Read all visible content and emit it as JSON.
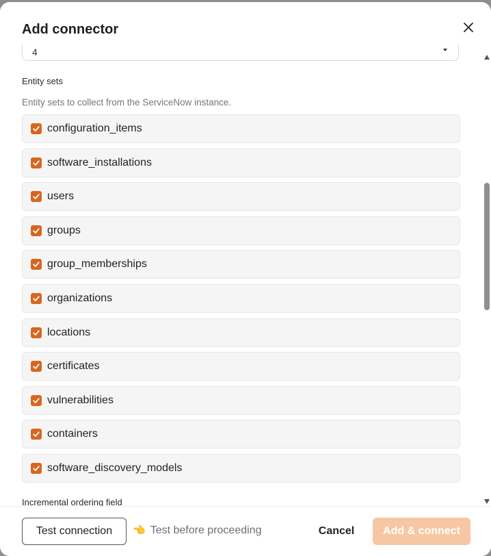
{
  "dialog": {
    "title": "Add connector",
    "close_icon": "close-icon"
  },
  "previous_field": {
    "value": "4"
  },
  "entity_sets": {
    "label": "Entity sets",
    "description": "Entity sets to collect from the ServiceNow instance.",
    "items": [
      {
        "label": "configuration_items",
        "checked": true
      },
      {
        "label": "software_installations",
        "checked": true
      },
      {
        "label": "users",
        "checked": true
      },
      {
        "label": "groups",
        "checked": true
      },
      {
        "label": "group_memberships",
        "checked": true
      },
      {
        "label": "organizations",
        "checked": true
      },
      {
        "label": "locations",
        "checked": true
      },
      {
        "label": "certificates",
        "checked": true
      },
      {
        "label": "vulnerabilities",
        "checked": true
      },
      {
        "label": "containers",
        "checked": true
      },
      {
        "label": "software_discovery_models",
        "checked": true
      }
    ]
  },
  "next_field": {
    "label": "Incremental ordering field"
  },
  "footer": {
    "test_button": "Test connection",
    "hint_icon": "pointing-hand-icon",
    "hint_text": "Test before proceeding",
    "cancel_button": "Cancel",
    "submit_button": "Add & connect"
  },
  "colors": {
    "checkbox": "#d9661f",
    "submit_disabled": "#f7c7a3"
  }
}
